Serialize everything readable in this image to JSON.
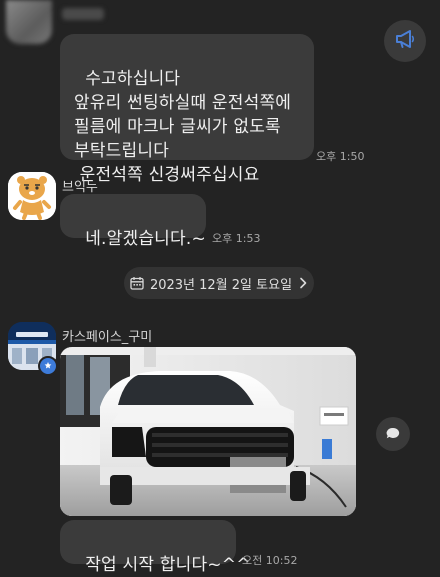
{
  "messages": {
    "first": {
      "text": "수고하십니다\n앞유리 썬팅하실때 운전석쪽에\n필름에 마크나 글씨가 없도록\n부탁드립니다\n 운전석쪽 신경써주십시요",
      "time": "오후 1:50"
    },
    "second": {
      "sender": "브익누",
      "text": "네.알겠습니다.~",
      "time": "오후 1:53"
    },
    "date_divider": "2023년 12월 2일 토요일",
    "third": {
      "sender": "카스페이스_구미",
      "text": "작업 시작 합니다~^^",
      "time": "오전 10:52"
    }
  },
  "icons": {
    "announcement": "megaphone-icon",
    "calendar": "calendar-icon",
    "chevron": "chevron-right-icon",
    "share": "share-icon",
    "verified": "verified-badge-icon"
  },
  "colors": {
    "background": "#232323",
    "bubble": "#3b3b3b",
    "fab_icon": "#4a7fd6"
  }
}
